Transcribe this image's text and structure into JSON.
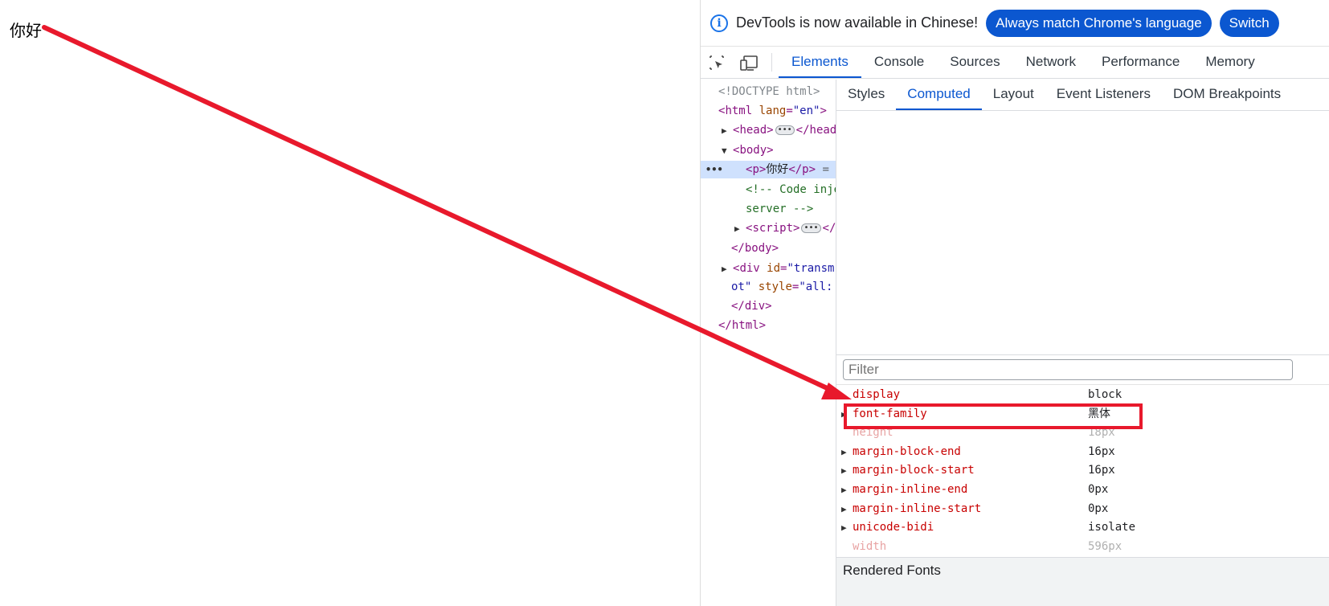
{
  "page": {
    "text": "你好"
  },
  "infobar": {
    "message": "DevTools is now available in Chinese!",
    "buttons": [
      "Always match Chrome's language",
      "Switch"
    ]
  },
  "toolbar": {
    "tabs": [
      "Elements",
      "Console",
      "Sources",
      "Network",
      "Performance",
      "Memory"
    ],
    "active_tab": "Elements"
  },
  "dom": {
    "doctype": "<!DOCTYPE html>",
    "html_tag": "html",
    "html_attr": "lang",
    "html_val": "\"en\"",
    "head": "head",
    "head_close": "</head",
    "body": "body",
    "p_open": "p",
    "p_text": "你好",
    "p_close": "p",
    "p_suffix": "=",
    "comment1": "<!-- Code inje",
    "comment2": "server -->",
    "script": "script",
    "script_close": "</",
    "body_close": "</body>",
    "div_tag": "div",
    "div_attr": "id",
    "div_val": "\"transm",
    "div_cont_val": "ot\"",
    "div_style_attr": "style",
    "div_style_val": "\"all:",
    "div_close": "</div>",
    "html_close": "</html>"
  },
  "side": {
    "tabs": [
      "Styles",
      "Computed",
      "Layout",
      "Event Listeners",
      "DOM Breakpoints"
    ],
    "active_tab": "Computed",
    "filter_placeholder": "Filter",
    "properties": [
      {
        "name": "display",
        "value": "block",
        "expandable": false,
        "inherited": false
      },
      {
        "name": "font-family",
        "value": "黑体",
        "expandable": true,
        "inherited": false
      },
      {
        "name": "height",
        "value": "18px",
        "expandable": false,
        "inherited": true
      },
      {
        "name": "margin-block-end",
        "value": "16px",
        "expandable": true,
        "inherited": false
      },
      {
        "name": "margin-block-start",
        "value": "16px",
        "expandable": true,
        "inherited": false
      },
      {
        "name": "margin-inline-end",
        "value": "0px",
        "expandable": true,
        "inherited": false
      },
      {
        "name": "margin-inline-start",
        "value": "0px",
        "expandable": true,
        "inherited": false
      },
      {
        "name": "unicode-bidi",
        "value": "isolate",
        "expandable": true,
        "inherited": false
      },
      {
        "name": "width",
        "value": "596px",
        "expandable": false,
        "inherited": true
      }
    ],
    "rendered_fonts_label": "Rendered Fonts"
  },
  "colors": {
    "accent": "#0b57d0",
    "annotation_red": "#e8192c",
    "selected_row": "#cfe1fd"
  }
}
